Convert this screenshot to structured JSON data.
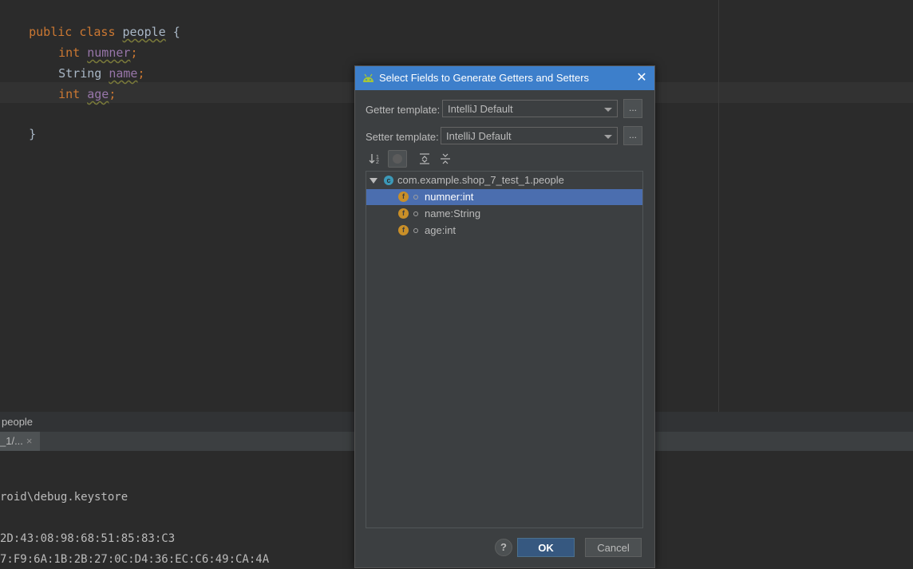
{
  "editor": {
    "lines": [
      {
        "kw": "public class ",
        "name": "people",
        "rest": " {"
      },
      {
        "kw": "int ",
        "name": "numner",
        "rest": ";"
      },
      {
        "plain": "String ",
        "name": "name",
        "rest": ";"
      },
      {
        "kw": "int ",
        "name": "age",
        "rest": ";"
      },
      {
        "plain": "}"
      }
    ]
  },
  "breadcrumb": {
    "text": "people"
  },
  "run_panel": {
    "tab_label": "_1/...",
    "tab_close": "×",
    "console_lines": [
      "roid\\debug.keystore",
      "2D:43:08:98:68:51:85:83:C3",
      "7:F9:6A:1B:2B:27:0C:D4:36:EC:C6:49:CA:4A"
    ]
  },
  "dialog": {
    "title": "Select Fields to Generate Getters and Setters",
    "close": "✕",
    "getter_label": "Getter template:",
    "getter_value": "IntelliJ Default",
    "setter_label": "Setter template:",
    "setter_value": "IntelliJ Default",
    "dots": "...",
    "tree": {
      "root": "com.example.shop_7_test_1.people",
      "class_icon_letter": "c",
      "field_icon_letter": "f",
      "fields": [
        "numner:int",
        "name:String",
        "age:int"
      ]
    },
    "help": "?",
    "ok": "OK",
    "cancel": "Cancel"
  },
  "colors": {
    "titlebar": "#3d7fcb",
    "selection": "#4b6eaf",
    "keyword": "#cc7832",
    "field": "#9876aa"
  }
}
